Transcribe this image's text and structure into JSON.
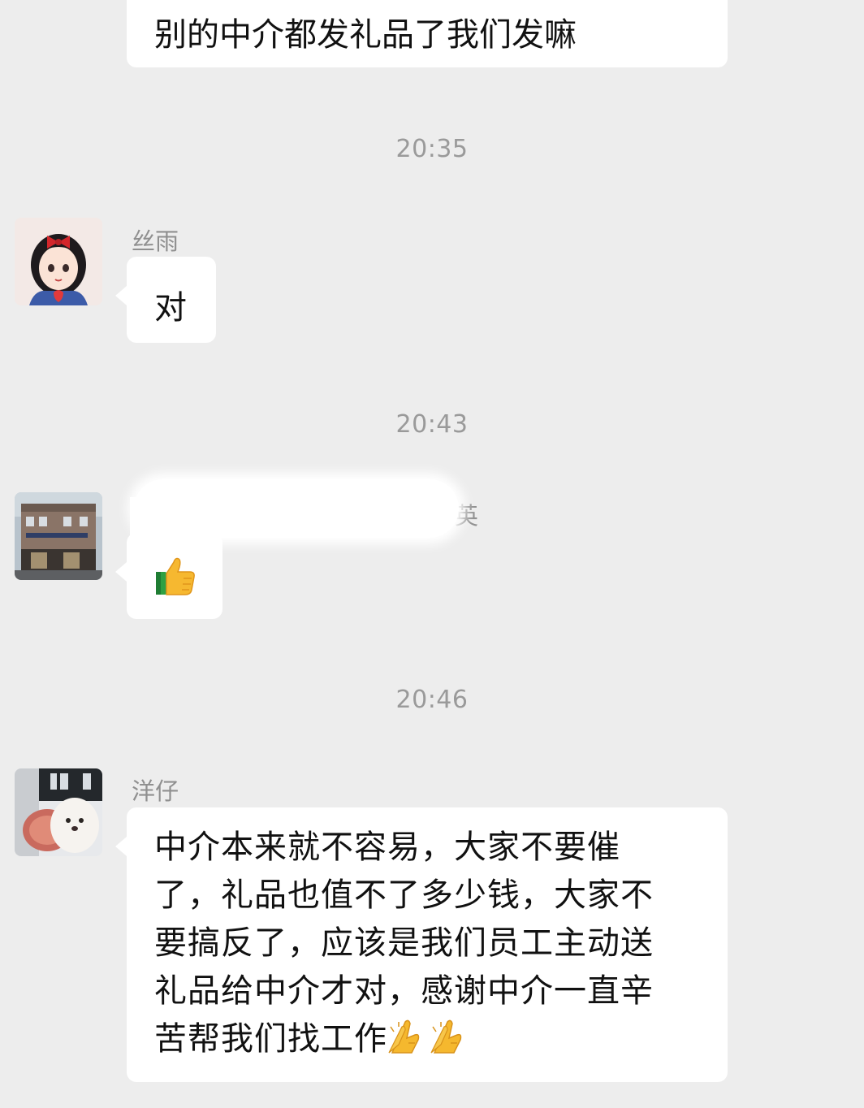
{
  "messages": [
    {
      "text": "别的中介都发礼品了我们发嘛"
    },
    {
      "time": "20:35",
      "sender": "丝雨",
      "text": "对"
    },
    {
      "time": "20:43",
      "sender_visible": "英",
      "emoji": "thumbs-up"
    },
    {
      "time": "20:46",
      "sender": "洋仔",
      "text": "中介本来就不容易，大家不要催了，礼品也值不了多少钱，大家不要搞反了，应该是我们员工主动送礼品给中介才对，感谢中介一直辛苦帮我们找工作",
      "lines": [
        "中介本来就不容易，大家不要催",
        "了，礼品也值不了多少钱，大家不",
        "要搞反了，应该是我们员工主动送",
        "礼品给中介才对，感谢中介一直辛",
        "苦帮我们找工作"
      ],
      "trailing_emoji": [
        "folded-hands",
        "folded-hands"
      ]
    }
  ],
  "colors": {
    "background": "#ededed",
    "bubble": "#ffffff",
    "time_text": "#9a9a9a",
    "name_text": "#8f8f8f"
  }
}
